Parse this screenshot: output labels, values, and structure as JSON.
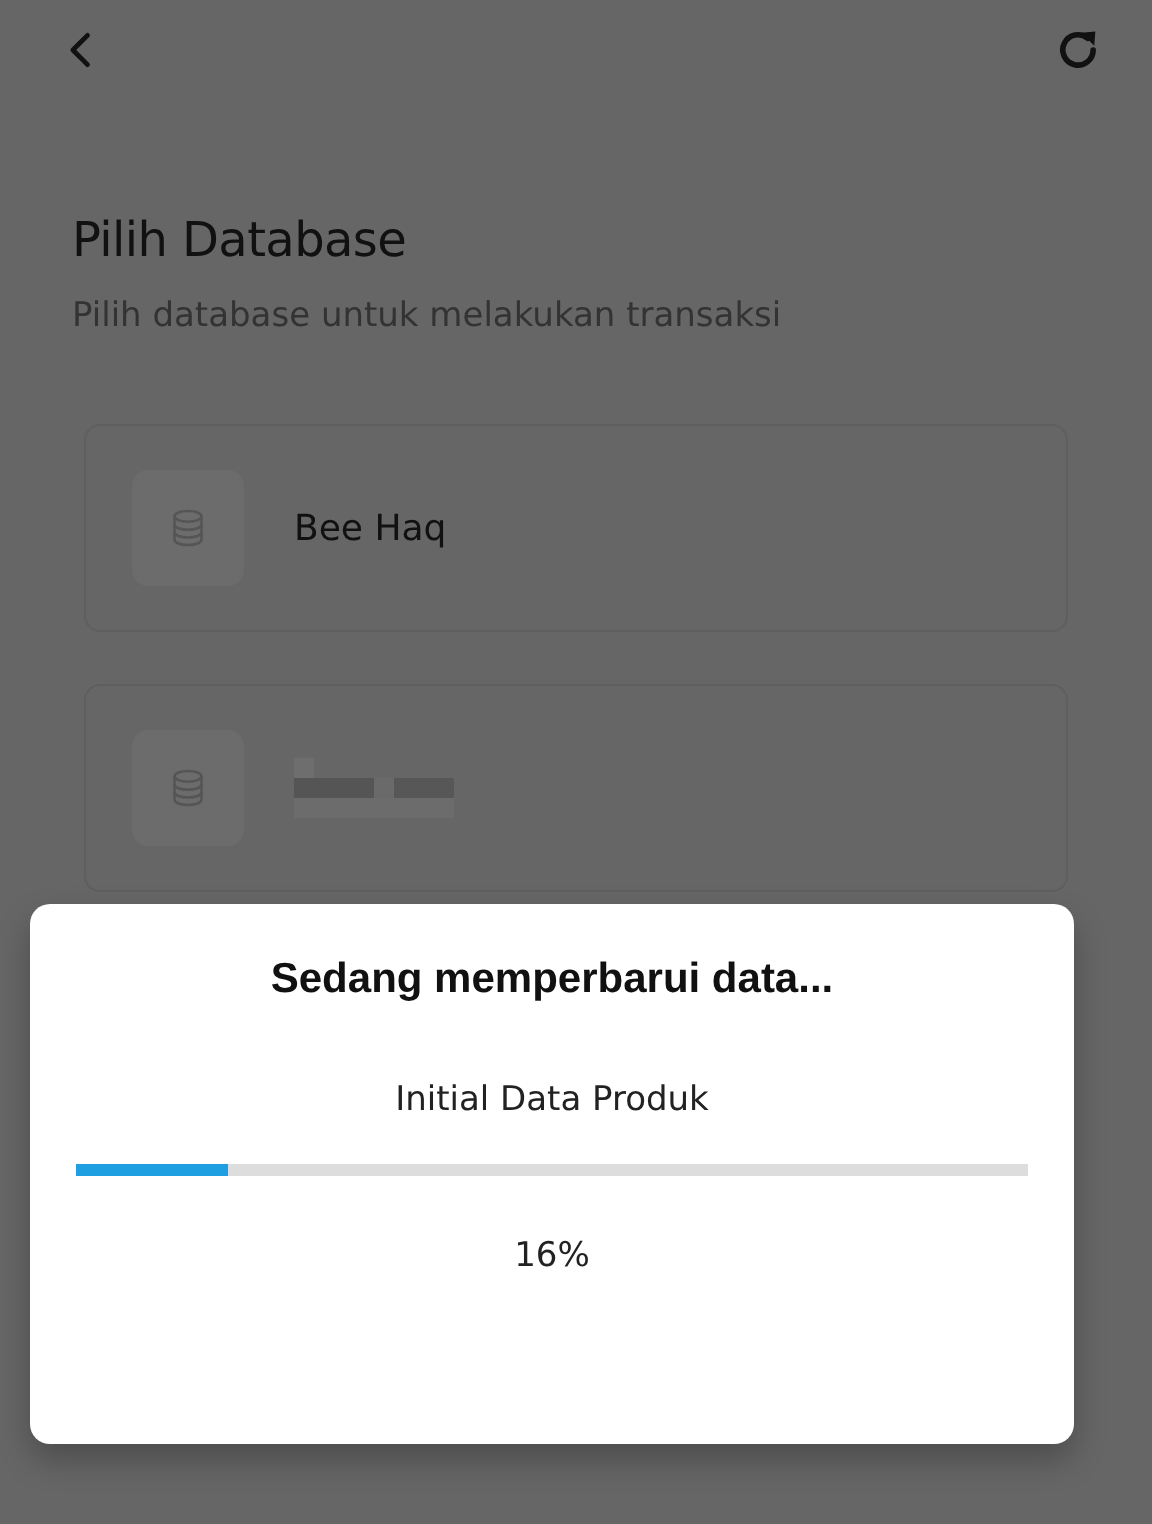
{
  "header": {
    "title": "Pilih Database",
    "subtitle": "Pilih database untuk melakukan transaksi"
  },
  "databases": [
    {
      "kind": "named",
      "name": "Bee Haq"
    },
    {
      "kind": "redacted"
    }
  ],
  "dialog": {
    "title": "Sedang memperbarui data...",
    "task": "Initial Data Produk",
    "progress": {
      "level": 0.16
    },
    "reading": "16%"
  }
}
